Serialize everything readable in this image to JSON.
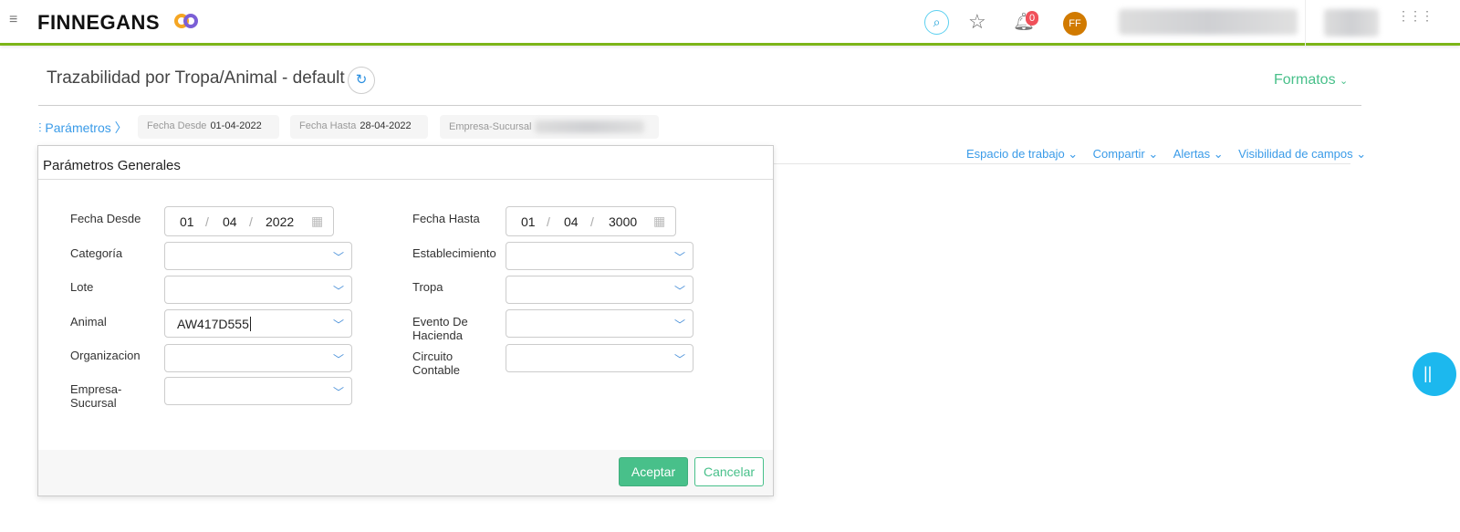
{
  "header": {
    "brand": "FINNEGANS",
    "notifications_count": "0",
    "avatar_initials": "FF"
  },
  "page": {
    "title": "Trazabilidad por Tropa/Animal - default",
    "formats": "Formatos"
  },
  "params_bar": {
    "label": "Parámetros",
    "chips": [
      {
        "label": "Fecha Desde",
        "value": "01-04-2022"
      },
      {
        "label": "Fecha Hasta",
        "value": "28-04-2022"
      },
      {
        "label": "Empresa-Sucursal",
        "value": ""
      }
    ]
  },
  "toolbar": {
    "items": [
      "Espacio de trabajo",
      "Compartir",
      "Alertas",
      "Visibilidad de campos"
    ]
  },
  "modal": {
    "title": "Parámetros Generales",
    "fecha_desde": {
      "label": "Fecha Desde",
      "day": "01",
      "month": "04",
      "year": "2022"
    },
    "fecha_hasta": {
      "label": "Fecha Hasta",
      "day": "01",
      "month": "04",
      "year": "3000"
    },
    "left": [
      {
        "label": "Categoría",
        "value": ""
      },
      {
        "label": "Lote",
        "value": ""
      },
      {
        "label": "Animal",
        "value": "AW417D555"
      },
      {
        "label": "Organizacion",
        "value": ""
      },
      {
        "label": "Empresa-Sucursal",
        "value": ""
      }
    ],
    "right": [
      {
        "label": "Establecimiento",
        "value": ""
      },
      {
        "label": "Tropa",
        "value": ""
      },
      {
        "label": "Evento De Hacienda",
        "value": ""
      },
      {
        "label": "Circuito Contable",
        "value": ""
      }
    ],
    "accept": "Aceptar",
    "cancel": "Cancelar"
  },
  "colors": {
    "accent_green": "#48c08a",
    "link_blue": "#3a9be8",
    "topbar_line": "#7cb518",
    "badge": "#f0505a",
    "avatar": "#d17a00"
  }
}
